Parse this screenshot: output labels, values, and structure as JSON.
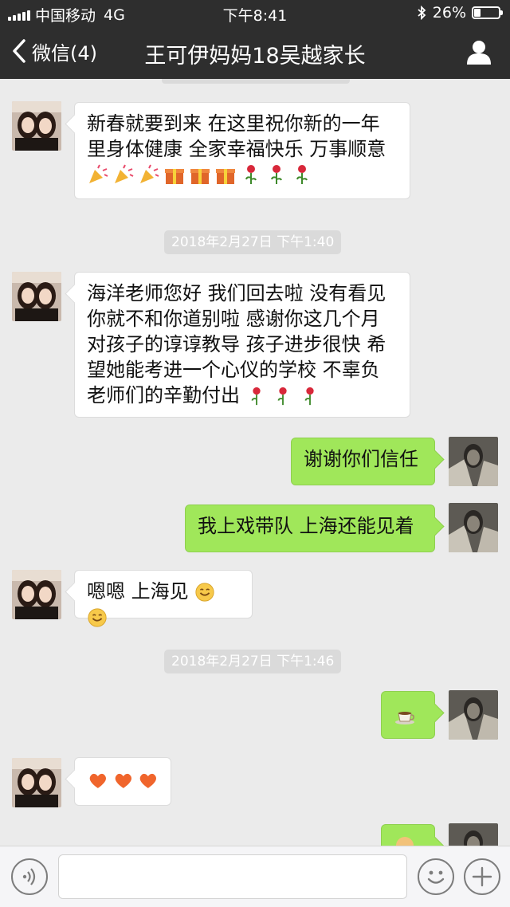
{
  "status": {
    "carrier": "中国移动",
    "network": "4G",
    "time": "下午8:41",
    "battery": "26%",
    "battery_level": 0.26
  },
  "nav": {
    "back_label": "微信(4)",
    "title": "王可伊妈妈18吴越家长"
  },
  "messages": [
    {
      "text": "新春就要到来 在这里祝你新的一年\n里身体健康 全家幸福快乐 万事顺意"
    },
    {
      "timestamp": "2018年2月27日 下午1:40"
    },
    {
      "text": "海洋老师您好 我们回去啦 没有看见\n你就不和你道别啦 感谢你这几个月\n对孩子的谆谆教导 孩子进步很快 希\n望她能考进一个心仪的学校 不辜负\n老师们的辛勤付出"
    },
    {
      "text": "谢谢你们信任"
    },
    {
      "text": "我上戏带队 上海还能见着"
    },
    {
      "text": "嗯嗯 上海见"
    },
    {
      "timestamp": "2018年2月27日 下午1:46"
    }
  ],
  "input": {
    "placeholder": ""
  },
  "colors": {
    "bar": "#2e2e2e",
    "background": "#ebebeb",
    "outgoing_bubble": "#a0e75a",
    "incoming_bubble": "#ffffff"
  }
}
